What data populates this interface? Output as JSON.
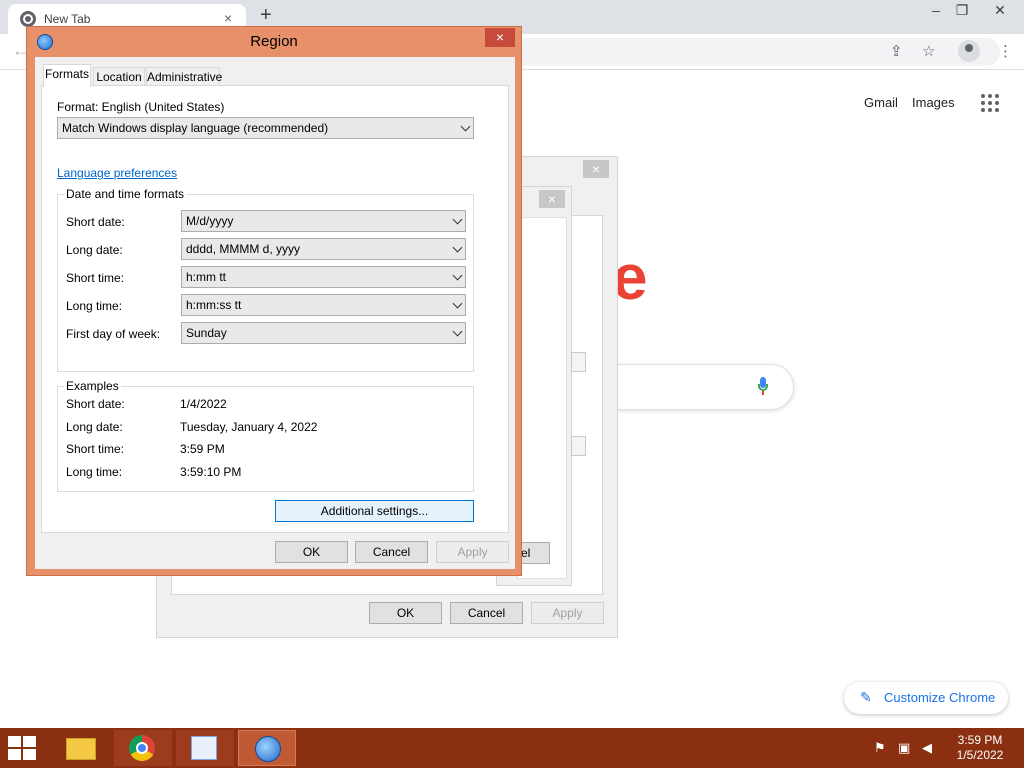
{
  "browser": {
    "tab_title": "New Tab",
    "tab_close": "×",
    "new_tab": "+",
    "win_minimize": "–",
    "win_restore": "❐",
    "win_close": "✕",
    "back": "←",
    "share_icon": "⇪",
    "star_icon": "☆",
    "menu_icon": "⋮"
  },
  "google": {
    "gmail": "Gmail",
    "images": "Images",
    "logo_fragment": "e",
    "customize_label": "Customize Chrome",
    "customize_icon": "✎"
  },
  "bg_dialog": {
    "close": "×",
    "ok": "OK",
    "cancel": "Cancel",
    "apply": "Apply",
    "partial_label": "el"
  },
  "region": {
    "title": "Region",
    "close": "×",
    "tabs": [
      "Formats",
      "Location",
      "Administrative"
    ],
    "format_label": "Format: English (United States)",
    "format_value": "Match Windows display language (recommended)",
    "language_link": "Language preferences",
    "datetime_group": "Date and time formats",
    "fields": [
      {
        "label": "Short date:",
        "value": "M/d/yyyy"
      },
      {
        "label": "Long date:",
        "value": "dddd, MMMM d, yyyy"
      },
      {
        "label": "Short time:",
        "value": "h:mm tt"
      },
      {
        "label": "Long time:",
        "value": "h:mm:ss tt"
      },
      {
        "label": "First day of week:",
        "value": "Sunday"
      }
    ],
    "examples_group": "Examples",
    "examples": [
      {
        "label": "Short date:",
        "value": "1/4/2022"
      },
      {
        "label": "Long date:",
        "value": "Tuesday, January 4, 2022"
      },
      {
        "label": "Short time:",
        "value": "3:59 PM"
      },
      {
        "label": "Long time:",
        "value": "3:59:10 PM"
      }
    ],
    "additional_settings": "Additional settings...",
    "ok": "OK",
    "cancel": "Cancel",
    "apply": "Apply"
  },
  "taskbar": {
    "time": "3:59 PM",
    "date": "1/5/2022",
    "tray_flag": "⚑",
    "tray_network": "▣",
    "tray_volume": "◀"
  },
  "colors": {
    "dialog_frame": "#e8906a",
    "taskbar": "#8a2f10",
    "link": "#0066cc",
    "accent": "#1a73e8"
  }
}
